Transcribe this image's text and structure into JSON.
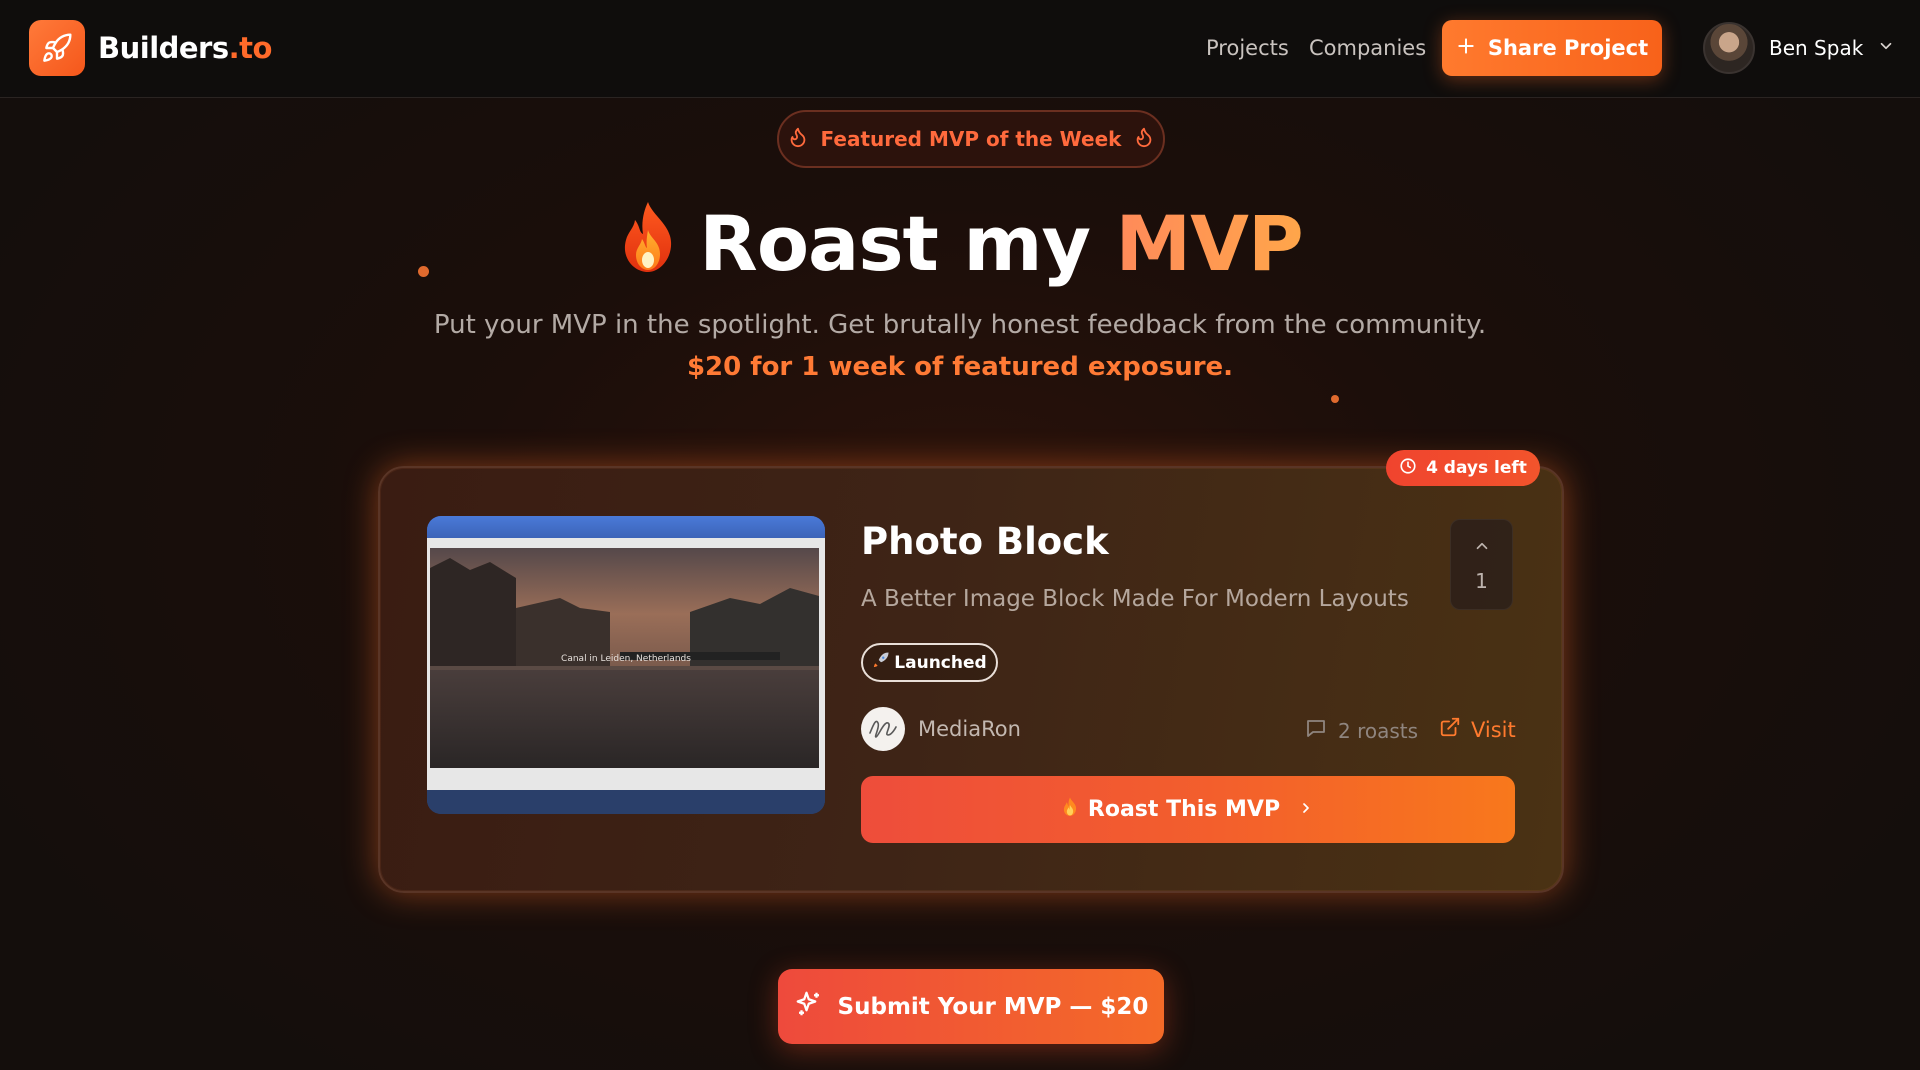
{
  "header": {
    "logo_text": "Builders",
    "logo_suffix": ".to",
    "nav": {
      "projects": "Projects",
      "companies": "Companies"
    },
    "share_label": "Share Project",
    "user_name": "Ben Spak"
  },
  "hero": {
    "featured_label": "Featured MVP of the Week",
    "title_main": "Roast my",
    "title_accent": "MVP",
    "subtitle": "Put your MVP in the spotlight. Get brutally honest feedback from the community.",
    "price_line": "$20 for 1 week of featured exposure."
  },
  "card": {
    "days_left": "4 days left",
    "screenshot_caption": "Canal in Leiden, Netherlands",
    "title": "Photo Block",
    "tagline": "A Better Image Block Made For Modern Layouts",
    "status": "Launched",
    "upvotes": "1",
    "maker": "MediaRon",
    "roasts": "2 roasts",
    "visit": "Visit",
    "roast_button": "Roast This MVP"
  },
  "submit_button": "Submit Your MVP — $20",
  "colors": {
    "accent": "#ff6a2a",
    "header_bg": "#0f0d0c",
    "badge_red": "#f0442e"
  },
  "icons": [
    "rocket-icon",
    "plus-icon",
    "chevron-down-icon",
    "flame-icon",
    "fire-emoji-icon",
    "clock-icon",
    "chevron-up-icon",
    "comment-icon",
    "external-link-icon",
    "chevron-right-icon",
    "sparkles-icon"
  ]
}
